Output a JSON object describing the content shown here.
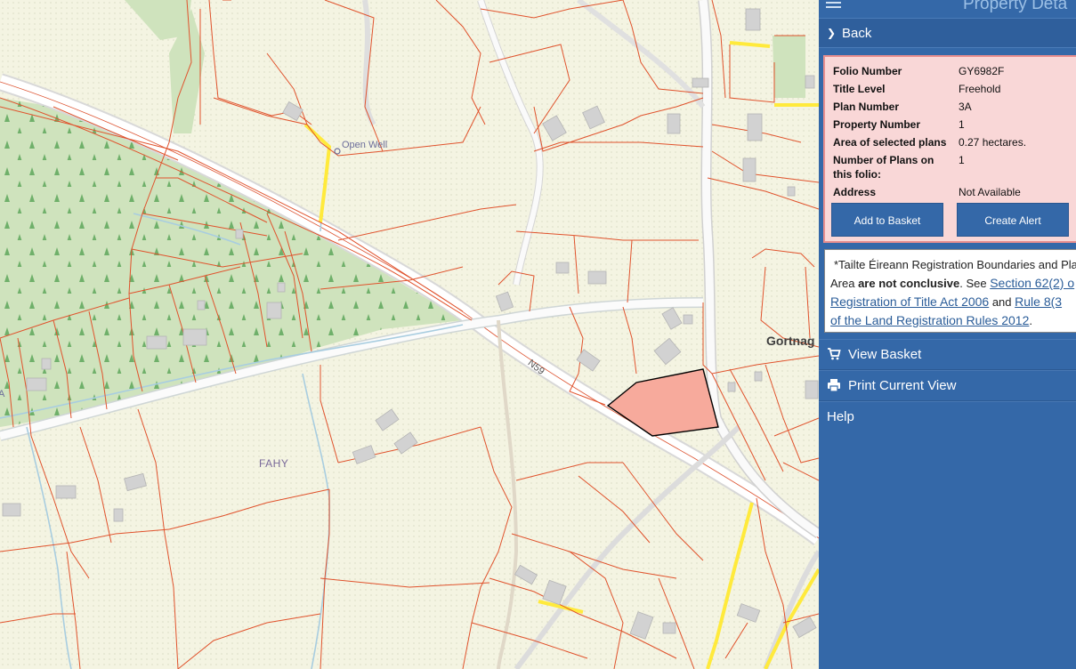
{
  "map": {
    "labels": {
      "fahy": "FAHY",
      "open_well": "Open Well",
      "road": "N59",
      "gortnag": "Gortnag",
      "edge_a": "A"
    }
  },
  "panel": {
    "title": "Property Deta",
    "back_label": "Back",
    "property": {
      "folio_number_label": "Folio Number",
      "folio_number": "GY6982F",
      "title_level_label": "Title Level",
      "title_level": "Freehold",
      "plan_number_label": "Plan Number",
      "plan_number": "3A",
      "property_number_label": "Property Number",
      "property_number": "1",
      "area_label": "Area of selected plans",
      "area": "0.27 hectares.",
      "plans_count_label_1": "Number of Plans on",
      "plans_count_label_2": "this folio:",
      "plans_count": "1",
      "address_label": "Address",
      "address": "Not Available"
    },
    "buttons": {
      "add_to_basket": "Add to Basket",
      "create_alert": "Create Alert"
    },
    "notice": {
      "line1": "*Tailte Éireann Registration Boundaries and Pla",
      "line2_pre": "Area ",
      "line2_bold": "are not conclusive",
      "line2_mid": ". See ",
      "link1a": "Section 62(2) o",
      "link1b": "Registration of Title Act 2006",
      "and": " and ",
      "link2a": "Rule 8(3",
      "link2b": "of the Land Registration Rules 2012",
      "end": "."
    },
    "menu": {
      "view_basket": "View Basket",
      "print_view": "Print Current View",
      "help": "Help"
    }
  },
  "colors": {
    "map_background": "#f4f4e2",
    "forest": "#cfe3bd",
    "parcel_line": "#e0522c",
    "selected_plot": "#f7aa9c",
    "minor_road": "#ffee44",
    "panel_blue": "#3468a8",
    "info_pink": "#f9d7d7"
  },
  "icons": {
    "menu": "hamburger-icon",
    "back": "chevron-right-icon",
    "basket": "shopping-cart-icon",
    "print": "printer-icon"
  }
}
